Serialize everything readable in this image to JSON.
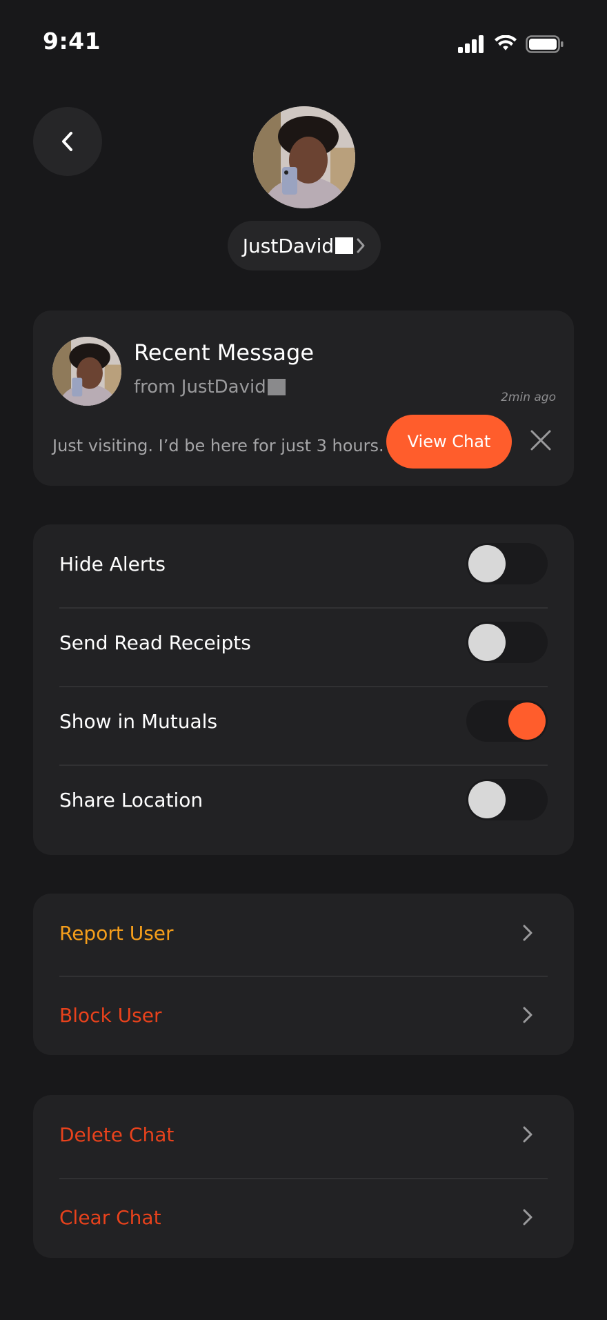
{
  "status_bar": {
    "time": "9:41",
    "icons": [
      "cellular-signal-icon",
      "wifi-icon",
      "battery-icon"
    ]
  },
  "header": {
    "back_icon": "chevron-left-icon",
    "username": "JustDavid",
    "name_chevron_icon": "chevron-right-icon"
  },
  "recent_message": {
    "title": "Recent Message",
    "from": "from JustDavid",
    "time": "2min ago",
    "text": "Just visiting. I’d be here for just 3 hours.",
    "view_chat_label": "View Chat",
    "close_icon": "close-icon"
  },
  "settings": {
    "items": [
      {
        "label": "Hide Alerts",
        "enabled": false
      },
      {
        "label": "Send Read Receipts",
        "enabled": false
      },
      {
        "label": "Show in Mutuals",
        "enabled": true
      },
      {
        "label": "Share Location",
        "enabled": false
      }
    ]
  },
  "safety_actions": [
    {
      "label": "Report User",
      "color": "#f59e1b"
    },
    {
      "label": "Block User",
      "color": "#e8421c"
    }
  ],
  "chat_actions": [
    {
      "label": "Delete Chat",
      "color": "#e8421c"
    },
    {
      "label": "Clear Chat",
      "color": "#e8421c"
    }
  ],
  "colors": {
    "accent": "#ff5d2c",
    "background": "#18181a",
    "card": "#222224"
  }
}
